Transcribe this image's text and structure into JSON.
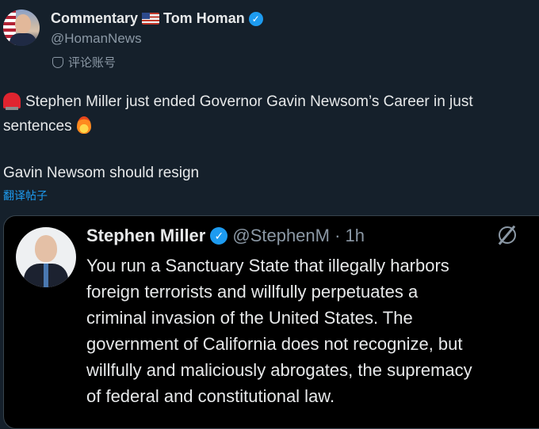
{
  "author": {
    "name_prefix": "Commentary",
    "name_suffix": "Tom Homan",
    "handle": "@HomanNews",
    "account_tag": "评论账号"
  },
  "post": {
    "line1": "Stephen Miller just ended Governor Gavin Newsom’s Career in just",
    "line2": "sentences",
    "line3": "Gavin Newsom should resign",
    "translate_label": "翻译帖子"
  },
  "quoted": {
    "name": "Stephen Miller",
    "handle_time": "@StephenM · 1h",
    "lines": [
      "You run a Sanctuary State that illegally harbors",
      "foreign terrorists and willfully perpetuates a",
      "criminal invasion of the United States. The",
      "government of California does not recognize, but",
      "willfully and maliciously abrogates, the supremacy",
      "of federal and constitutional law."
    ]
  },
  "icons": {
    "verified": "verified-badge-icon",
    "flag": "us-flag-icon",
    "siren": "siren-icon",
    "fire": "fire-icon",
    "grok": "grok-icon",
    "mask": "mask-icon"
  },
  "colors": {
    "background": "#15202b",
    "quote_background": "#000000",
    "link": "#1d9bf0",
    "muted": "#8b98a5",
    "verified": "#1d9bf0"
  }
}
